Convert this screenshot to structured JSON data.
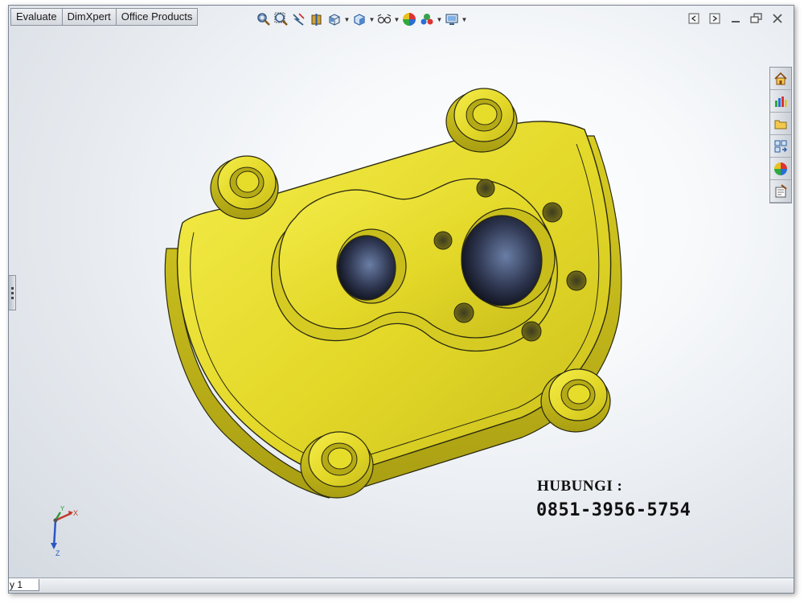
{
  "tabs": [
    "Evaluate",
    "DimXpert",
    "Office Products"
  ],
  "toolbar_icons": [
    "zoom-to-fit-icon",
    "zoom-to-area-icon",
    "previous-view-icon",
    "section-view-icon",
    "view-orientation-icon",
    "display-style-icon",
    "hide-show-items-icon",
    "edit-appearance-icon",
    "apply-scene-icon",
    "view-settings-icon"
  ],
  "window_controls": [
    "restore-pane-icon",
    "split-pane-icon",
    "minimize-icon",
    "restore-window-icon",
    "close-icon"
  ],
  "task_pane": [
    "solidworks-resources-icon",
    "design-library-icon",
    "file-explorer-icon",
    "view-palette-icon",
    "appearances-scenes-icon",
    "custom-properties-icon"
  ],
  "overlay": {
    "title": "HUBUNGI :",
    "phone": "0851-3956-5754"
  },
  "triad": {
    "x": "X",
    "y": "Y",
    "z": "Z"
  },
  "model_tabs": {
    "active": "y 1"
  },
  "colors": {
    "part": "#e6dc2a",
    "part_shadow": "#b3a818",
    "edge": "#1e1e12"
  }
}
